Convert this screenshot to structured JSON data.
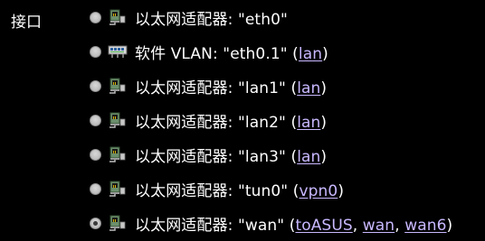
{
  "label": "接口",
  "interfaces": [
    {
      "type": "以太网适配器",
      "name": "\"eth0\"",
      "networks": [],
      "checked": false,
      "icon": "ethernet-port-icon"
    },
    {
      "type": "软件 VLAN",
      "name": "\"eth0.1\"",
      "networks": [
        "lan"
      ],
      "checked": false,
      "icon": "vlan-switch-icon"
    },
    {
      "type": "以太网适配器",
      "name": "\"lan1\"",
      "networks": [
        "lan"
      ],
      "checked": false,
      "icon": "ethernet-port-icon"
    },
    {
      "type": "以太网适配器",
      "name": "\"lan2\"",
      "networks": [
        "lan"
      ],
      "checked": false,
      "icon": "ethernet-port-icon"
    },
    {
      "type": "以太网适配器",
      "name": "\"lan3\"",
      "networks": [
        "lan"
      ],
      "checked": false,
      "icon": "ethernet-port-icon"
    },
    {
      "type": "以太网适配器",
      "name": "\"tun0\"",
      "networks": [
        "vpn0"
      ],
      "checked": false,
      "icon": "ethernet-port-icon"
    },
    {
      "type": "以太网适配器",
      "name": "\"wan\"",
      "networks": [
        "toASUS",
        "wan",
        "wan6"
      ],
      "checked": true,
      "icon": "ethernet-port-icon"
    }
  ],
  "colors": {
    "background": "#000000",
    "text": "#ffffff",
    "link": "#c9b8ff"
  }
}
